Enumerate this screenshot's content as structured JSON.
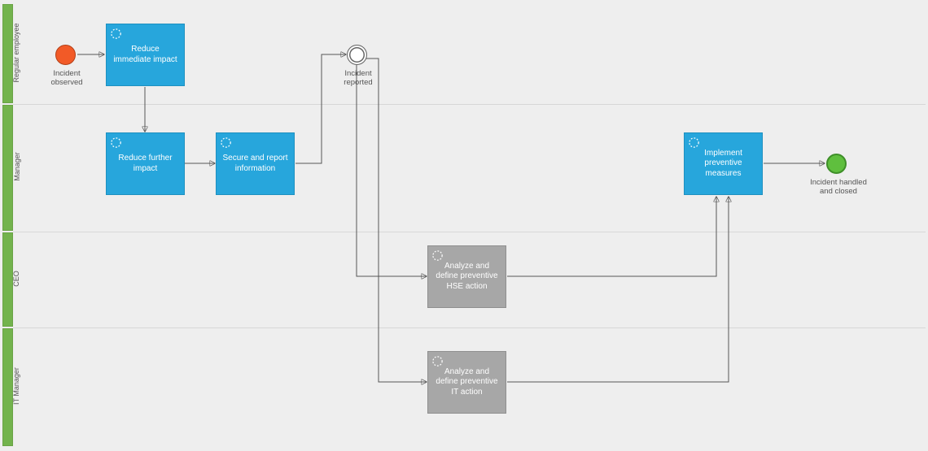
{
  "lanes": [
    {
      "id": "regular-employee",
      "label": "Regular employee"
    },
    {
      "id": "manager",
      "label": "Manager"
    },
    {
      "id": "ceo",
      "label": "CEO"
    },
    {
      "id": "it-manager",
      "label": "IT Manager"
    }
  ],
  "events": {
    "start": {
      "label": "Incident observed"
    },
    "mid": {
      "label": "Incident reported"
    },
    "end": {
      "label": "Incident handled and closed"
    }
  },
  "tasks": {
    "reduce_immediate": {
      "label": "Reduce immediate impact"
    },
    "reduce_further": {
      "label": "Reduce further impact"
    },
    "secure_report": {
      "label": "Secure and report information"
    },
    "analyze_hse": {
      "label": "Analyze and define preventive HSE action"
    },
    "analyze_it": {
      "label": "Analyze and define preventive IT action"
    },
    "implement": {
      "label": "Implement preventive measures"
    }
  },
  "colors": {
    "task_blue": "#27a6dc",
    "task_gray": "#a7a7a7",
    "lane_green": "#73b34d",
    "start_orange": "#f25a27",
    "end_green": "#5fbf3e"
  }
}
